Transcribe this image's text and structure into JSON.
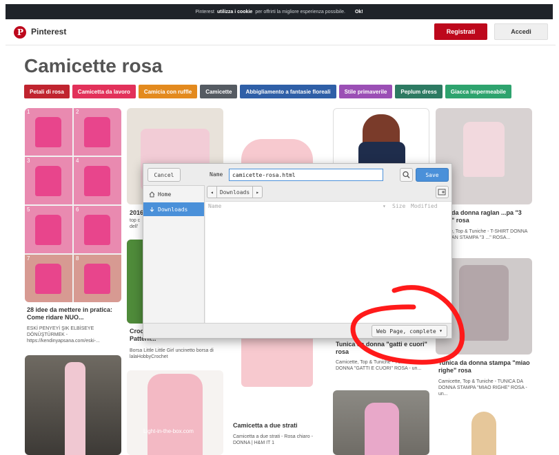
{
  "cookie_bar": {
    "text_pre": "Pinterest",
    "text_bold": "utilizza i cookie",
    "text_post": "per offrirti la migliore esperienza possibile.",
    "ok_label": "Ok!"
  },
  "header": {
    "brand": "Pinterest",
    "register_label": "Registrati",
    "login_label": "Accedi"
  },
  "page_title": "Camicette rosa",
  "tags": [
    {
      "label": "Petali di rosa",
      "color": "#c0242f"
    },
    {
      "label": "Camicetta da lavoro",
      "color": "#e2315a"
    },
    {
      "label": "Camicia con ruffle",
      "color": "#e38a1e"
    },
    {
      "label": "Camicette",
      "color": "#555b62"
    },
    {
      "label": "Abbigliamento a fantasie floreali",
      "color": "#2f5fa7"
    },
    {
      "label": "Stile primaverile",
      "color": "#9b4fb5"
    },
    {
      "label": "Peplum dress",
      "color": "#2d7a62"
    },
    {
      "label": "Giacca impermeabile",
      "color": "#2ea36e"
    }
  ],
  "pins": {
    "p1": {
      "title": "28 idee da mettere in pratica: Come ridare NUO...",
      "desc": "ESKİ PENYEYİ ŞIK ELBİSEYE DÖNÜŞTÜRMEK - https://kendinyapsana.com/eski-..."
    },
    "p1_numbers": [
      "1",
      "2",
      "3",
      "4",
      "5",
      "6",
      "7",
      "8"
    ],
    "p2": {
      "title_prefix": "2016",
      "desc_a": "top c",
      "desc_b": "dell'"
    },
    "p3": {
      "title": "Croc... Little Girl Crochet Pattern...",
      "desc": "Borsa Little Little Girl uncinetto borsa di lalaHobbyCrochet"
    },
    "p4": {
      "title": "Camicetta a due strati",
      "desc": "Camicetta a due strati - Rosa chiaro - DONNA | H&M IT 1"
    },
    "p5": {
      "title": "Tunica da donna \"gatti e cuori\" rosa",
      "desc": "Camicette, Top & Tuniche - TUNICA DA DONNA \"GATTI E CUORI\" ROSA - un..."
    },
    "p6": {
      "title": "...irt da donna raglan ...pa \"3 gatti\" rosa",
      "desc": "...cette, Top & Tuniche - T-SHIRT DONNA RAGLAN STAMPA \"3 ...\" ROSA..."
    },
    "p7": {
      "title": "Tunica da donna stampa \"miao righe\" rosa",
      "desc": "Camicette, Top & Tuniche - TUNICA DA DONNA STAMPA \"MIAO RIGHE\" ROSA - un..."
    },
    "watermark": "Light-in-the-box.com"
  },
  "dialog": {
    "cancel_label": "Cancel",
    "name_label": "Name",
    "filename": "camicette-rosa.html",
    "save_label": "Save",
    "sidebar": [
      {
        "label": "Home",
        "icon": "home-icon"
      },
      {
        "label": "Downloads",
        "icon": "download-icon"
      }
    ],
    "path_segment": "Downloads",
    "columns": {
      "name": "Name",
      "size": "Size",
      "modified": "Modified"
    },
    "filetype": "Web Page, complete"
  }
}
